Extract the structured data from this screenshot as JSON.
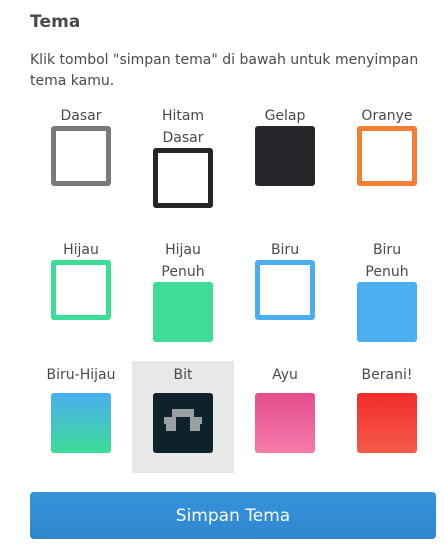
{
  "header": {
    "title": "Tema",
    "description": "Klik tombol \"simpan tema\" di bawah untuk menyimpan tema kamu."
  },
  "themes": [
    {
      "label": "Dasar",
      "style": "outline",
      "color": "#7a7a7a"
    },
    {
      "label": "Hitam\nDasar",
      "style": "outline",
      "color": "#26262a"
    },
    {
      "label": "Gelap",
      "style": "solid",
      "color": "#25272b"
    },
    {
      "label": "Oranye",
      "style": "outline",
      "color": "#f47f33"
    },
    {
      "label": "Hijau",
      "style": "outline",
      "color": "#3ddc97"
    },
    {
      "label": "Hijau\nPenuh",
      "style": "solid",
      "color": "#3ddc97"
    },
    {
      "label": "Biru",
      "style": "outline",
      "color": "#4aaef0"
    },
    {
      "label": "Biru\nPenuh",
      "style": "solid",
      "color": "#4aaef0"
    },
    {
      "label": "Biru-Hijau",
      "style": "gradient",
      "color_top": "#4aaef0",
      "color_bottom": "#3ddc97"
    },
    {
      "label": "Bit",
      "style": "bit",
      "color": "#0d222b",
      "selected": true
    },
    {
      "label": "Ayu",
      "style": "gradient",
      "color_top": "#e54d8e",
      "color_bottom": "#f57aa8"
    },
    {
      "label": "Berani!",
      "style": "gradient",
      "color_top": "#f22c2c",
      "color_bottom": "#f55a4a"
    }
  ],
  "actions": {
    "save_label": "Simpan Tema"
  },
  "colors": {
    "accent": "#2f8ad3",
    "selected_bg": "#e8e8e8",
    "text": "#4a4a4a"
  }
}
